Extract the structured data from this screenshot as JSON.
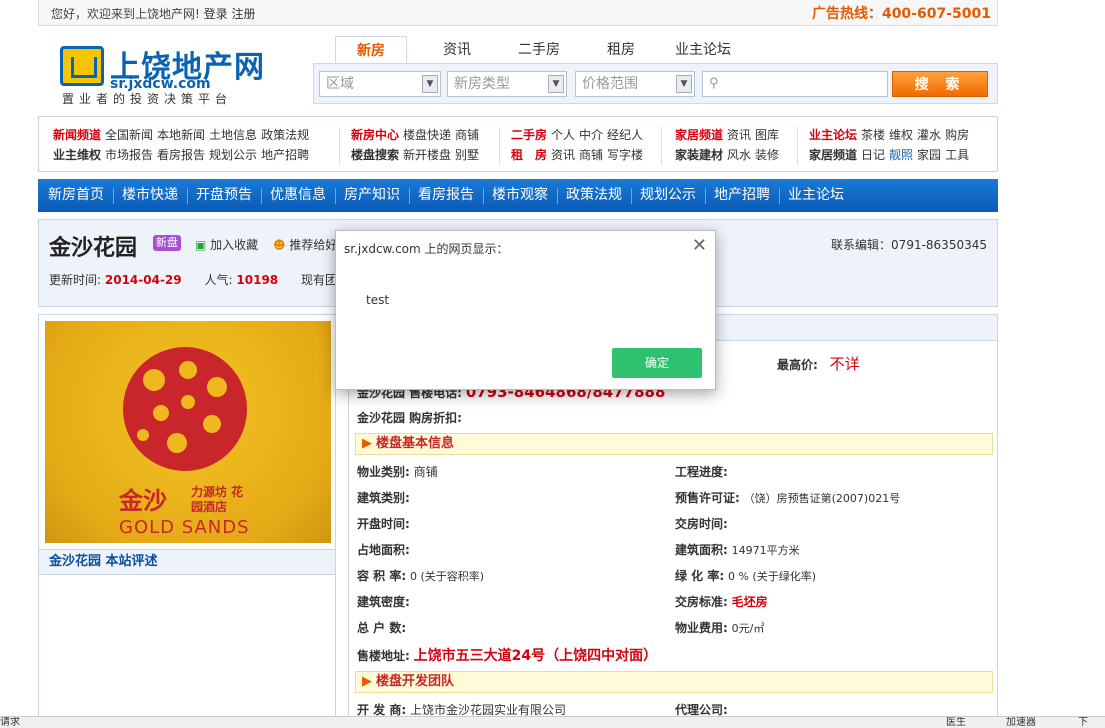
{
  "top": {
    "welcome": "您好，欢迎来到上饶地产网!",
    "login": "登录",
    "register": "注册",
    "hotline": "广告热线：400-607-5001"
  },
  "logo": {
    "title": "上饶地产网",
    "url": "sr.jxdcw.com",
    "slogan": "置业者的投资决策平台"
  },
  "tabs": [
    "新房",
    "资讯",
    "二手房",
    "租房",
    "业主论坛"
  ],
  "search": {
    "area": "区域",
    "type": "新房类型",
    "price": "价格范围",
    "button": "搜 索"
  },
  "channels": {
    "g1": {
      "row1": {
        "head": "新闻频道",
        "items": [
          "全国新闻",
          "本地新闻",
          "土地信息",
          "政策法规"
        ]
      },
      "row2": {
        "head": "业主维权",
        "items": [
          "市场报告",
          "看房报告",
          "规划公示",
          "地产招聘"
        ]
      }
    },
    "g2": {
      "row1": {
        "head": "新房中心",
        "items": [
          "楼盘快递",
          "商铺"
        ]
      },
      "row2": {
        "head": "楼盘搜索",
        "items": [
          "新开楼盘",
          "别墅"
        ]
      }
    },
    "g3": {
      "row1": {
        "head": "二手房",
        "items": [
          "个人",
          "中介",
          "经纪人"
        ]
      },
      "row2": {
        "head": "租　房",
        "items": [
          "资讯",
          "商铺",
          "写字楼"
        ]
      }
    },
    "g4": {
      "row1": {
        "head": "家居频道",
        "items": [
          "资讯",
          "图库"
        ]
      },
      "row2": {
        "head": "家装建材",
        "items": [
          "风水",
          "装修"
        ]
      }
    },
    "g5": {
      "row1": {
        "head": "业主论坛",
        "items": [
          "茶楼",
          "维权",
          "灌水",
          "购房"
        ]
      },
      "row2": {
        "head": "家居频道",
        "items": [
          "日记",
          "靓照",
          "家园",
          "工具"
        ]
      }
    }
  },
  "nav": [
    "新房首页",
    "楼市快递",
    "开盘预告",
    "优惠信息",
    "房产知识",
    "看房报告",
    "楼市观察",
    "政策法规",
    "规划公示",
    "地产招聘",
    "业主论坛"
  ],
  "property": {
    "name": "金沙花园",
    "badge": "新盘",
    "fav": "加入收藏",
    "share": "推荐给好",
    "updated_label": "更新时间:",
    "updated": "2014-04-29",
    "popularity_label": "人气:",
    "popularity": "10198",
    "group_text": "现有团购",
    "contact": "联系编辑：0791-86350345"
  },
  "photo": {
    "cn": "金沙",
    "en": "GOLD SANDS",
    "sub": "力源坊 花园酒店"
  },
  "review_head": "金沙花园 本站评述",
  "info": {
    "max_price_label": "最高价:",
    "max_price": "不详",
    "phone_partial_label": "金沙花园 售楼电话:",
    "phone_partial": "0793-8464868/8477888",
    "discount_label": "金沙花园 购房折扣:",
    "sec1": "楼盘基本信息",
    "rows": [
      {
        "k1": "物业类别:",
        "v1": "商铺",
        "k2": "工程进度:",
        "v2": ""
      },
      {
        "k1": "建筑类别:",
        "v1": "",
        "k2": "预售许可证:",
        "v2": "（饶）房预售证第(2007)021号"
      },
      {
        "k1": "开盘时间:",
        "v1": "",
        "k2": "交房时间:",
        "v2": ""
      },
      {
        "k1": "占地面积:",
        "v1": "",
        "k2": "建筑面积:",
        "v2": "14971平方米"
      },
      {
        "k1": "容 积 率:",
        "v1": "0 (关于容积率)",
        "k2": "绿 化 率:",
        "v2": "0 % (关于绿化率)"
      },
      {
        "k1": "建筑密度:",
        "v1": "",
        "k2": "交房标准:",
        "v2": "毛坯房"
      },
      {
        "k1": "总 户 数:",
        "v1": "",
        "k2": "物业费用:",
        "v2": "0元/㎡"
      }
    ],
    "address_label": "售楼地址:",
    "address": "上饶市五三大道24号（上饶四中对面）",
    "sec2": "楼盘开发团队",
    "dev_label": "开 发 商:",
    "dev": "上饶市金沙花园实业有限公司",
    "agent_label": "代理公司:"
  },
  "dialog": {
    "title": "sr.jxdcw.com 上的网页显示：",
    "message": "test",
    "ok": "确定"
  },
  "status": {
    "left": "请求",
    "r1": "医生",
    "r2": "加速器",
    "r3": "下"
  }
}
